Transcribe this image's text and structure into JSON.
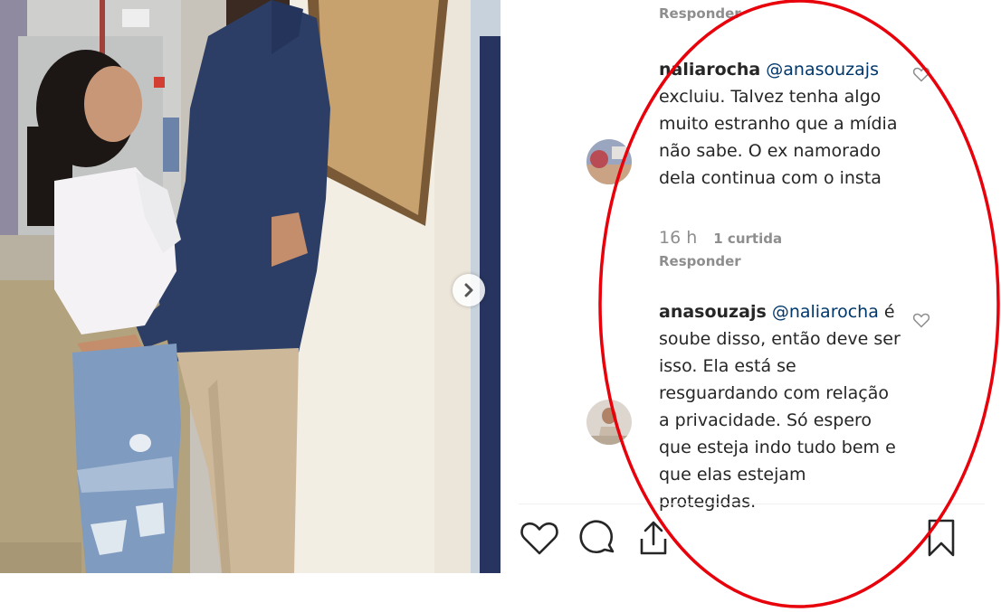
{
  "comments_panel": {
    "top_reply_label": "Responder",
    "comments": [
      {
        "username": "naliarocha",
        "mention": "@anasouzajs",
        "text": "excluiu. Talvez tenha algo muito estranho que a mídia não sabe. O ex namorado dela continua com o insta",
        "time": "16 h",
        "likes": "1 curtida",
        "reply_label": "Responder",
        "avatar_icon": "user-avatar-photo",
        "like_icon": "heart-outline-icon"
      },
      {
        "username": "anasouzajs",
        "mention": "@naliarocha",
        "text": "é soube disso, então deve ser isso. Ela está se resguardando com relação a privacidade. Só espero que esteja indo tudo bem e que elas estejam protegidas.",
        "avatar_icon": "user-avatar-photo",
        "like_icon": "heart-outline-icon"
      }
    ]
  },
  "post_actions": {
    "like_icon": "heart-outline-icon",
    "comment_icon": "comment-bubble-icon",
    "share_icon": "share-upload-icon",
    "save_icon": "bookmark-outline-icon"
  },
  "photo": {
    "next_icon": "chevron-right-icon"
  },
  "colors": {
    "annotation": "#e8000b",
    "meta_gray": "#8e8e8e",
    "mention_blue": "#00376b"
  }
}
